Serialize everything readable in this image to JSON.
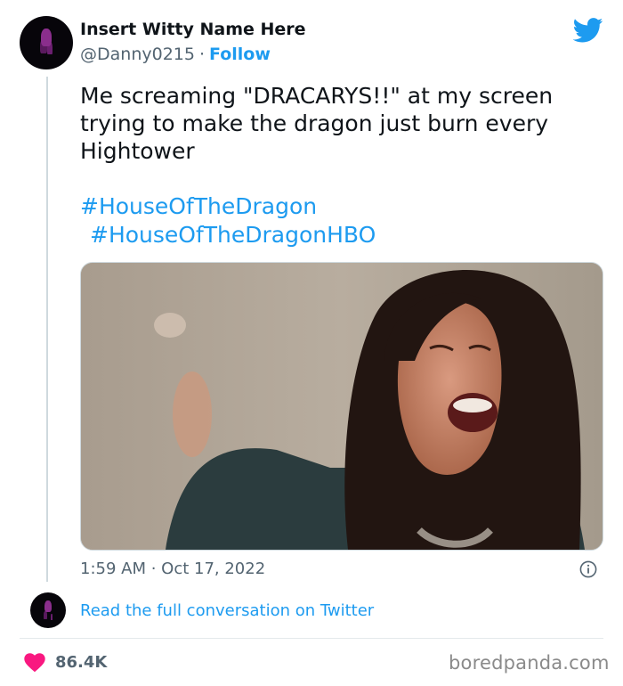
{
  "author": {
    "name": "Insert Witty Name Here",
    "handle": "@Danny0215",
    "separator": "·",
    "follow_label": "Follow"
  },
  "brand": {
    "icon": "twitter-bird-icon",
    "color": "#1d9bf0"
  },
  "tweet": {
    "text": "Me screaming \"DRACARYS!!\" at my screen trying to make the dragon just burn every Hightower",
    "hashtags": [
      "#HouseOfTheDragon",
      "#HouseOfTheDragonHBO"
    ],
    "media_icon": "photo-crying-woman",
    "timestamp": "1:59 AM · Oct 17, 2022"
  },
  "conversation": {
    "link_label": "Read the full conversation on Twitter"
  },
  "engagement": {
    "likes": "86.4K",
    "like_color": "#f91880"
  },
  "watermark": "boredpanda.com"
}
